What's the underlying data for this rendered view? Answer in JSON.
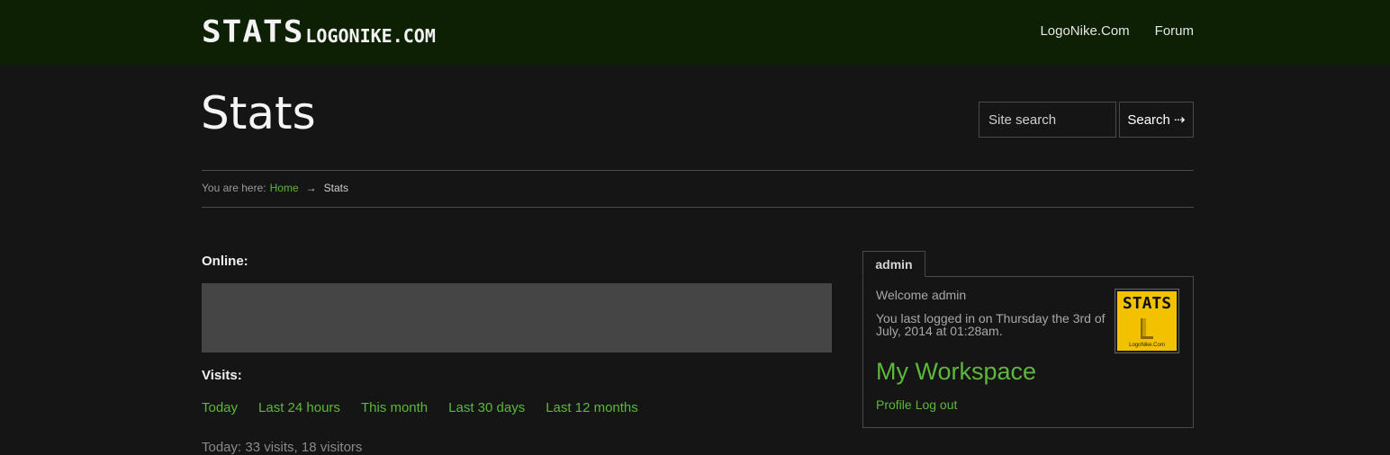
{
  "header": {
    "logo_main": "STATS",
    "logo_domain": "LOGONIKE.COM",
    "nav": [
      "LogoNike.Com",
      "Forum"
    ]
  },
  "page": {
    "title": "Stats"
  },
  "search": {
    "placeholder": "Site search",
    "button_label": "Search ⇢"
  },
  "breadcrumb": {
    "prefix": "You are here:",
    "home": "Home",
    "separator": "→",
    "current": "Stats"
  },
  "main": {
    "online_label": "Online:",
    "visits_label": "Visits:",
    "visit_tabs": [
      "Today",
      "Last 24 hours",
      "This month",
      "Last 30 days",
      "Last 12 months"
    ],
    "summary": "Today: 33 visits, 18 visitors"
  },
  "user_panel": {
    "tab_label": "admin",
    "welcome": "Welcome admin",
    "last_login": "You last logged in on Thursday the 3rd of July, 2014 at 01:28am.",
    "avatar_title": "STATS",
    "avatar_caption": "LogoNike.Com",
    "workspace_link": "My Workspace",
    "links": [
      "Profile",
      "Log out"
    ]
  },
  "colors": {
    "header_bg": "#0d2004",
    "page_bg": "#151515",
    "link_green": "#5cb83a",
    "online_box": "#454545",
    "avatar_bg": "#f2c200"
  }
}
